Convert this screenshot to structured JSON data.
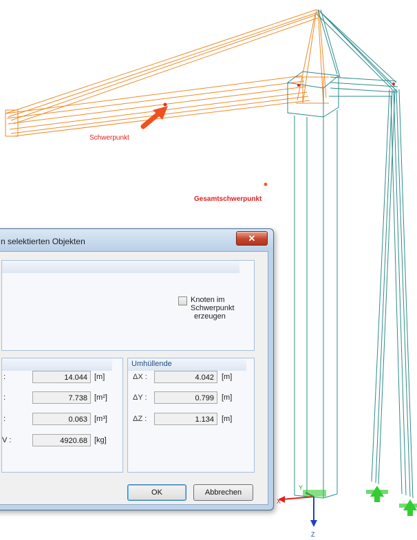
{
  "scene": {
    "label_schwerpunkt": "Schwerpunkt",
    "label_gesamtschwerpunkt": "Gesamtschwerpunkt",
    "axis_x": "X",
    "axis_y": "Y",
    "axis_z": "Z",
    "colors": {
      "selected": "#f08a24",
      "structure": "#2e8b8b",
      "label_red": "#e02020",
      "support": "#33cc33"
    }
  },
  "dialog": {
    "title": "n selektierten Objekten",
    "close_icon": "close-icon",
    "top_panel": {
      "checkbox_label_line1": "Knoten im Schwerpunkt",
      "checkbox_label_line2": "erzeugen",
      "checkbox_checked": false
    },
    "left_panel": {
      "rows": [
        {
          "value": "14.044",
          "unit": "[m]"
        },
        {
          "value": "7.738",
          "unit": "[m²]"
        },
        {
          "value": "0.063",
          "unit": "[m³]"
        },
        {
          "value": "4920.68",
          "unit": "[kg]",
          "label_suffix": "V :"
        }
      ]
    },
    "right_panel": {
      "title": "Umhüllende",
      "rows": [
        {
          "label": "ΔX :",
          "value": "4.042",
          "unit": "[m]"
        },
        {
          "label": "ΔY :",
          "value": "0.799",
          "unit": "[m]"
        },
        {
          "label": "ΔZ :",
          "value": "1.134",
          "unit": "[m]"
        }
      ]
    },
    "ok_label": "OK",
    "cancel_label": "Abbrechen"
  }
}
